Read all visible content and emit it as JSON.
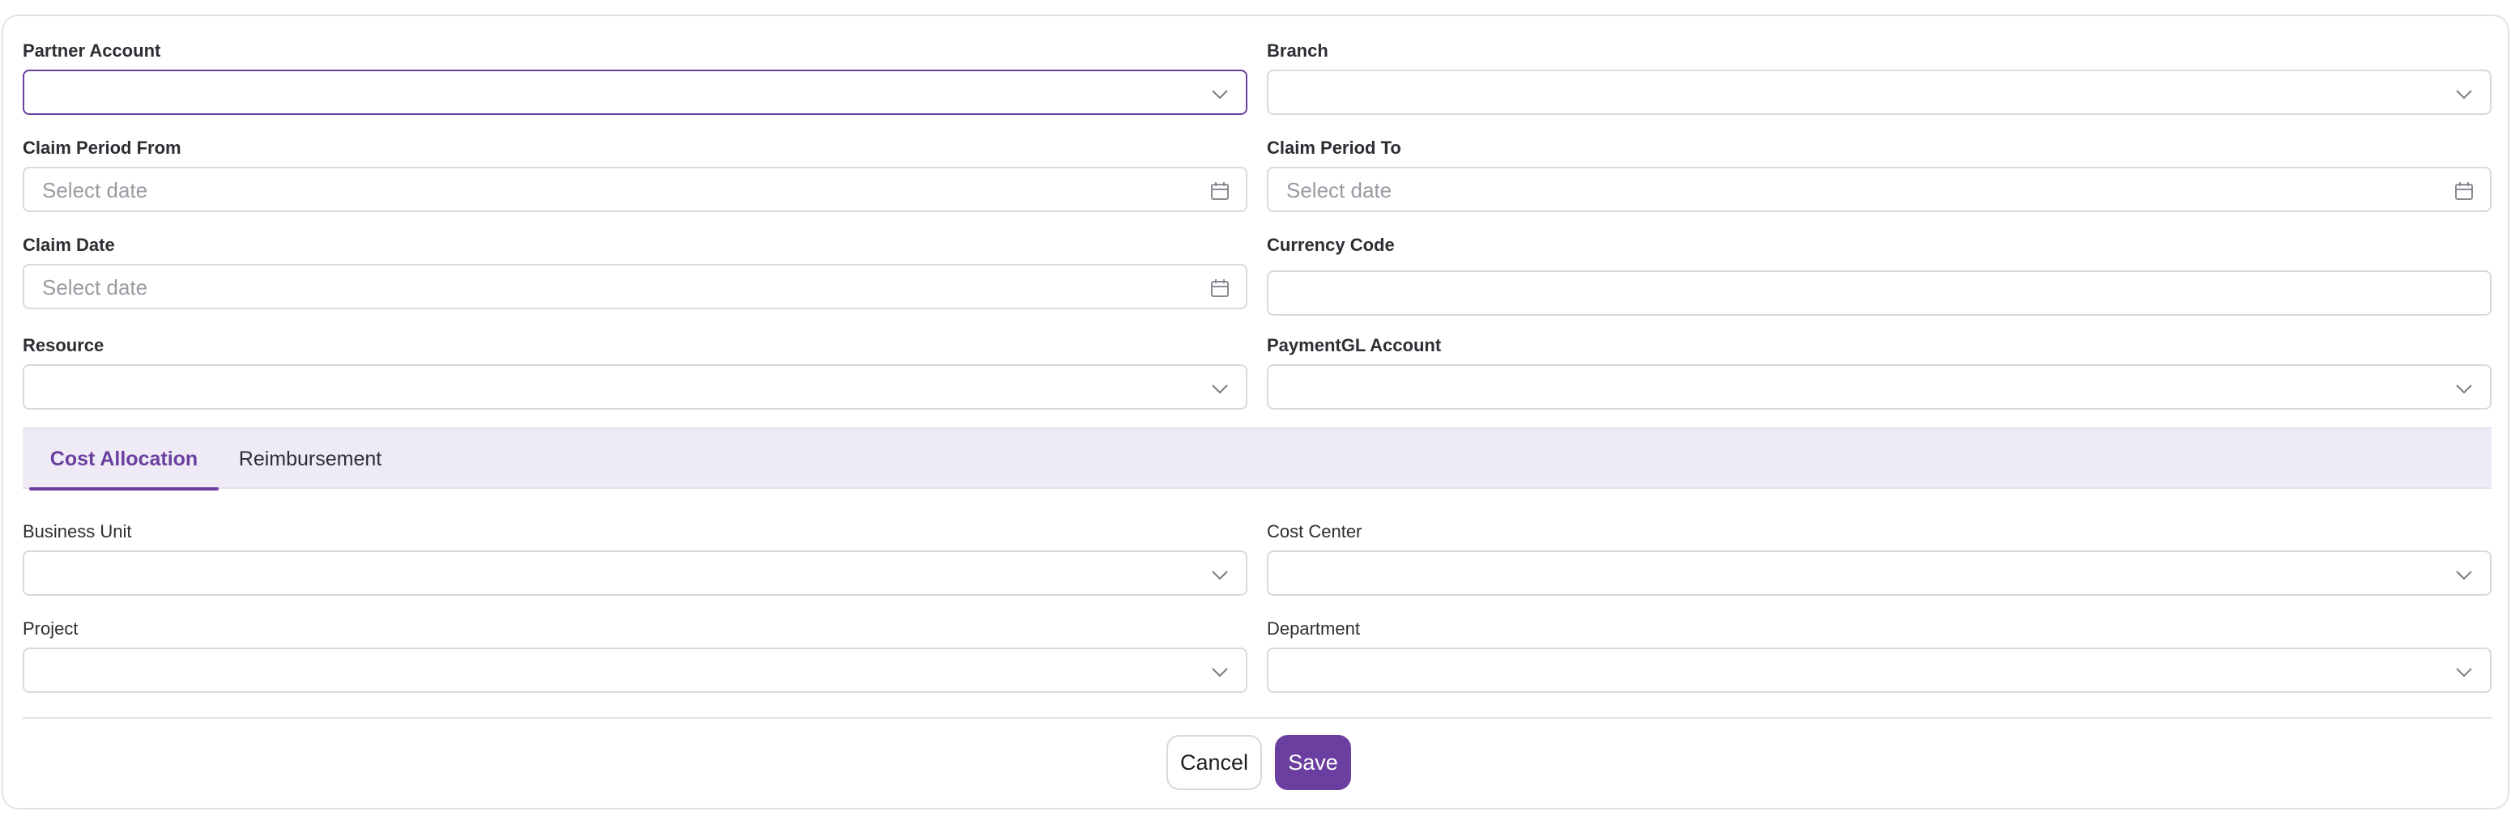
{
  "form": {
    "partner_account": {
      "label": "Partner Account",
      "value": "",
      "icon": "chevron-down-icon"
    },
    "branch": {
      "label": "Branch",
      "value": "",
      "icon": "chevron-down-icon"
    },
    "claim_period_from": {
      "label": "Claim Period From",
      "placeholder": "Select date",
      "icon": "calendar-icon"
    },
    "claim_period_to": {
      "label": "Claim Period To",
      "placeholder": "Select date",
      "icon": "calendar-icon"
    },
    "claim_date": {
      "label": "Claim Date",
      "placeholder": "Select date",
      "icon": "calendar-icon"
    },
    "currency_code": {
      "label": "Currency Code",
      "value": ""
    },
    "resource": {
      "label": "Resource",
      "value": "",
      "icon": "chevron-down-icon"
    },
    "payment_gl_account": {
      "label": "PaymentGL Account",
      "value": "",
      "icon": "chevron-down-icon"
    }
  },
  "tabs": [
    {
      "label": "Cost Allocation",
      "active": true
    },
    {
      "label": "Reimbursement",
      "active": false
    }
  ],
  "cost_allocation": {
    "business_unit": {
      "label": "Business Unit",
      "value": ""
    },
    "cost_center": {
      "label": "Cost Center",
      "value": ""
    },
    "project": {
      "label": "Project",
      "value": ""
    },
    "department": {
      "label": "Department",
      "value": ""
    }
  },
  "actions": {
    "cancel_label": "Cancel",
    "save_label": "Save"
  },
  "colors": {
    "accent": "#6b3fa0",
    "tab_bar_bg": "#efebf6",
    "border": "#d9d9de",
    "placeholder": "#9a9aa2"
  }
}
